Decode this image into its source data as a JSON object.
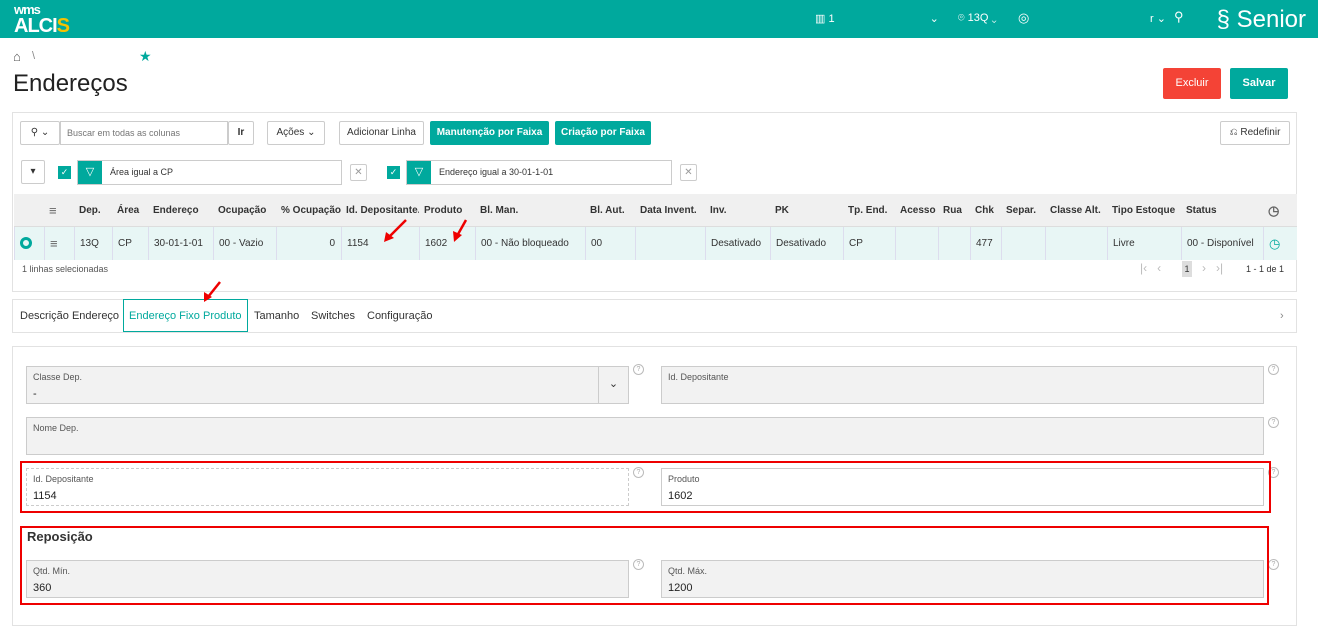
{
  "header": {
    "logo_top": "wms",
    "logo_main": "ALCI",
    "logo_accent": "S",
    "warehouse": "1",
    "location": "13Q",
    "user": "r",
    "brand": "Senior"
  },
  "breadcrumb": {
    "sep": "\\"
  },
  "page": {
    "title": "Endereços",
    "delete": "Excluir",
    "save": "Salvar"
  },
  "toolbar": {
    "search_placeholder": "Buscar em todas as colunas",
    "go": "Ir",
    "actions": "Ações",
    "add_line": "Adicionar Linha",
    "maint": "Manutenção por Faixa",
    "create": "Criação por Faixa",
    "reset": "Redefinir"
  },
  "filters": [
    {
      "label": "Área igual a CP"
    },
    {
      "label": "Endereço igual a 30-01-1-01"
    }
  ],
  "table": {
    "columns": [
      "Dep.",
      "Área",
      "Endereço",
      "Ocupação",
      "% Ocupação",
      "Id. Depositante.",
      "Produto",
      "Bl. Man.",
      "Bl. Aut.",
      "Data Invent.",
      "Inv.",
      "PK",
      "Tp. End.",
      "Acesso",
      "Rua",
      "Chk",
      "Separ.",
      "Classe Alt.",
      "Tipo Estoque",
      "Status"
    ],
    "rows": [
      [
        "13Q",
        "CP",
        "30-01-1-01",
        "00 - Vazio",
        "0",
        "1154",
        "1602",
        "00 - Não bloqueado",
        "00",
        "",
        "Desativado",
        "Desativado",
        "CP",
        "",
        "",
        "477",
        "",
        "",
        "Livre",
        "00 - Disponível"
      ]
    ],
    "selected": "1 linhas selecionadas",
    "page": "1",
    "range": "1 - 1 de 1"
  },
  "tabs": [
    "Descrição Endereço",
    "Endereço Fixo Produto",
    "Tamanho",
    "Switches",
    "Configuração"
  ],
  "form": {
    "classe_dep": {
      "label": "Classe Dep.",
      "value": "-"
    },
    "id_dep_top": {
      "label": "Id. Depositante",
      "value": ""
    },
    "nome_dep": {
      "label": "Nome Dep.",
      "value": ""
    },
    "id_dep": {
      "label": "Id. Depositante",
      "value": "1154"
    },
    "produto": {
      "label": "Produto",
      "value": "1602"
    },
    "reposicao": "Reposição",
    "qtd_min": {
      "label": "Qtd. Mín.",
      "value": "360"
    },
    "qtd_max": {
      "label": "Qtd. Máx.",
      "value": "1200"
    }
  }
}
